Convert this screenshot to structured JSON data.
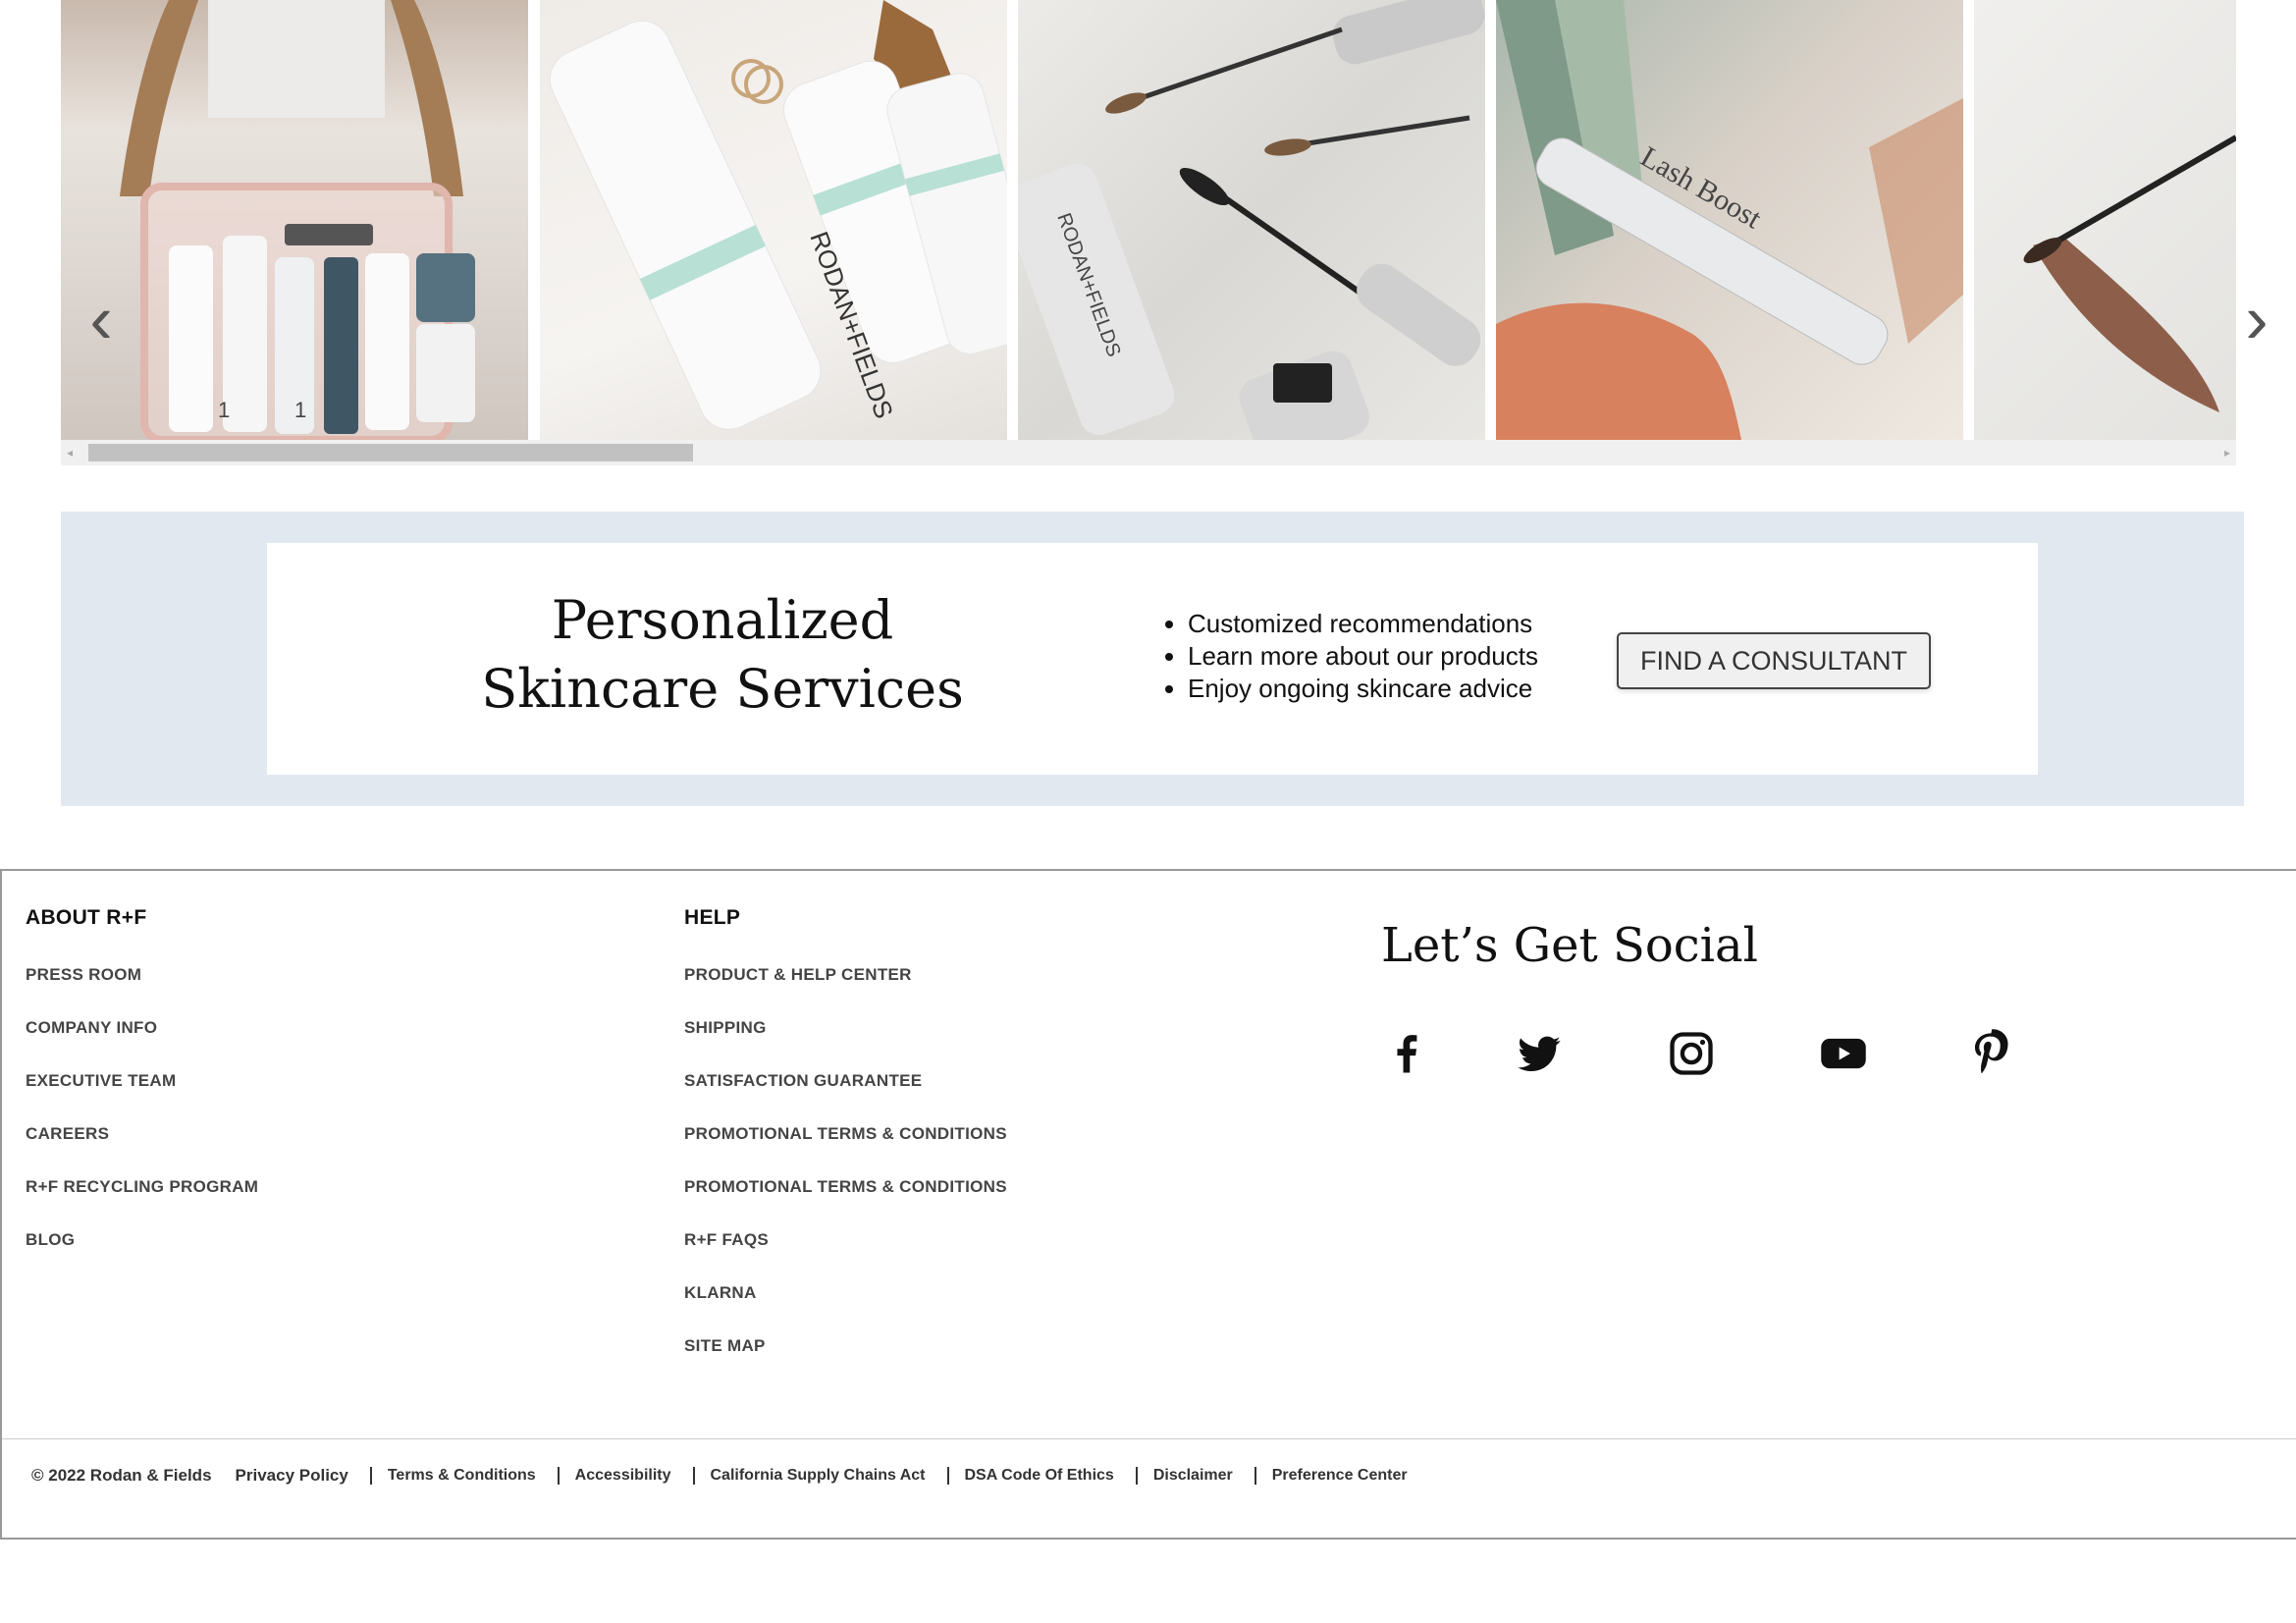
{
  "carousel": {
    "slides": [
      {
        "text": ""
      },
      {
        "text": "RODAN+FIELDS"
      },
      {
        "text": "RODAN+FIELDS"
      },
      {
        "text": "Lash Boost"
      },
      {
        "text": ""
      }
    ],
    "prev_icon": "chevron-left-icon",
    "next_icon": "chevron-right-icon",
    "prev_glyph": "‹",
    "next_glyph": "›"
  },
  "banner": {
    "title": "Personalized Skincare Services",
    "bullets": [
      "Customized recommendations",
      "Learn more about our products",
      "Enjoy ongoing skincare advice"
    ],
    "button_label": "FIND A CONSULTANT",
    "background_color": "#e1e8ef"
  },
  "footer": {
    "about": {
      "heading": "ABOUT R+F",
      "links": [
        "PRESS ROOM",
        "COMPANY INFO",
        "EXECUTIVE TEAM",
        "CAREERS",
        "R+F RECYCLING PROGRAM",
        "BLOG"
      ]
    },
    "help": {
      "heading": "HELP",
      "links": [
        "PRODUCT & HELP CENTER",
        "SHIPPING",
        "SATISFACTION GUARANTEE",
        "PROMOTIONAL TERMS & CONDITIONS",
        "PROMOTIONAL TERMS & CONDITIONS",
        "R+F FAQS",
        "KLARNA",
        "SITE MAP"
      ]
    },
    "social": {
      "title": "Let’s Get Social",
      "icons": [
        "facebook-icon",
        "twitter-icon",
        "instagram-icon",
        "youtube-icon",
        "pinterest-icon"
      ]
    },
    "legal": {
      "copyright": "© 2022 Rodan & Fields",
      "links": [
        "Privacy Policy",
        "Terms & Conditions",
        "Accessibility",
        "California Supply Chains Act",
        "DSA Code Of Ethics",
        "Disclaimer",
        "Preference Center"
      ]
    }
  }
}
